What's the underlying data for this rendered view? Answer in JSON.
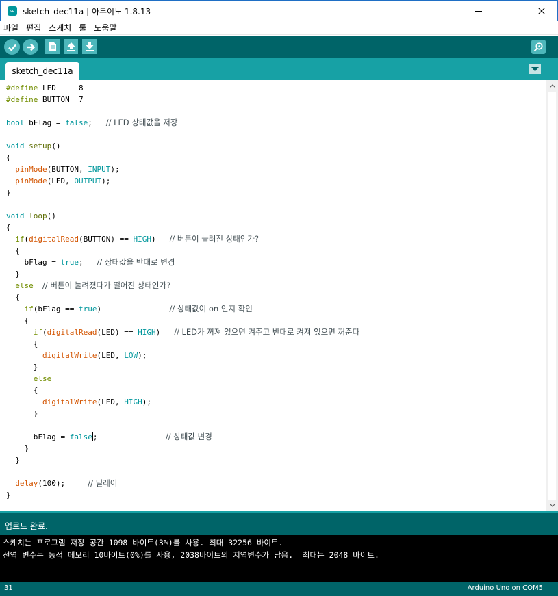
{
  "window": {
    "title": "sketch_dec11a | 아두이노 1.8.13",
    "app_icon_label": "∞"
  },
  "menu": {
    "items": [
      "파일",
      "편집",
      "스케치",
      "툴",
      "도움말"
    ]
  },
  "toolbar": {
    "icons": [
      "verify-check-icon",
      "upload-arrow-icon",
      "new-file-icon",
      "open-up-arrow-icon",
      "save-down-arrow-icon",
      "serial-monitor-magnifier-icon"
    ],
    "accent_color": "#006468",
    "button_color": "#4db7bb"
  },
  "tabs": {
    "items": [
      {
        "label": "sketch_dec11a"
      }
    ]
  },
  "editor": {
    "lines": [
      "#define LED     8",
      "#define BUTTON  7",
      "",
      "bool bFlag = false;   // LED 상태값을 저장",
      "",
      "void setup()",
      "{",
      "  pinMode(BUTTON, INPUT);",
      "  pinMode(LED, OUTPUT);",
      "}",
      "",
      "void loop()",
      "{",
      "  if(digitalRead(BUTTON) == HIGH)   // 버튼이 눌려진 상태인가?",
      "  {",
      "    bFlag = true;   // 상태값을 반대로 변경",
      "  }",
      "  else  // 버튼이 눌려졌다가 떨어진 상태인가?",
      "  {",
      "    if(bFlag == true)               // 상태값이 on 인지 확인",
      "    {",
      "      if(digitalRead(LED) == HIGH)   // LED가 꺼져 있으면 켜주고 반대로 켜져 있으면 꺼준다",
      "      {",
      "        digitalWrite(LED, LOW);",
      "      }",
      "      else",
      "      {",
      "        digitalWrite(LED, HIGH);",
      "      }",
      "",
      "      bFlag = false;               // 상태값 변경",
      "    }",
      "  }",
      "",
      "  delay(100);     // 딜레이",
      "}"
    ]
  },
  "status": {
    "message": "업로드 완료."
  },
  "console": {
    "lines": [
      "스케치는 프로그램 저장 공간 1098 바이트(3%)를 사용. 최대 32256 바이트.",
      "전역 변수는 동적 메모리 10바이트(0%)를 사용, 2038바이트의 지역변수가 남음.  최대는 2048 바이트."
    ]
  },
  "footer": {
    "line_number": "31",
    "board_port": "Arduino Uno on COM5"
  }
}
